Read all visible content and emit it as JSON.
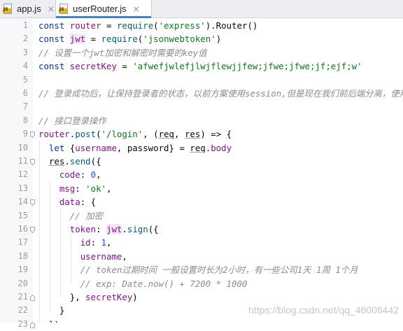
{
  "tabs": [
    {
      "label": "app.js",
      "icon": "js-file-icon",
      "active": false
    },
    {
      "label": "userRouter.js",
      "icon": "js-file-icon",
      "active": true
    }
  ],
  "tab_close_glyph": "×",
  "js_badge": "JS",
  "line_numbers": [
    "1",
    "2",
    "3",
    "4",
    "5",
    "6",
    "7",
    "8",
    "9",
    "10",
    "11",
    "12",
    "13",
    "14",
    "15",
    "16",
    "17",
    "18",
    "19",
    "20",
    "21",
    "22",
    "23"
  ],
  "code": {
    "l1_const": "const",
    "l1_name": "router",
    "l1_eq": " = ",
    "l1_req": "require",
    "l1_open": "(",
    "l1_str": "'express'",
    "l1_rest": ").Router()",
    "l2_const": "const",
    "l2_name": "jwt",
    "l2_eq": " = ",
    "l2_req": "require",
    "l2_open": "(",
    "l2_str": "'jsonwebtoken'",
    "l2_rest": ")",
    "l3": "// 设置一个jwt加密和解密时需要的key值",
    "l4_const": "const",
    "l4_name": "secretKey",
    "l4_eq": " = ",
    "l4_str": "'afwefjwlefjlwjflewjjfew;jfwe;jfwe;jf;ejf;w'",
    "l6": "// 登录成功后，让保持登录者的状态，以前方案使用session,但是现在我们前后端分离，使用jwt",
    "l8": "// 接口登录操作",
    "l9_a": "router",
    "l9_b": ".",
    "l9_c": "post",
    "l9_d": "(",
    "l9_e": "'/login'",
    "l9_f": ", (",
    "l9_g": "req",
    "l9_h": ", ",
    "l9_i": "res",
    "l9_j": ") => {",
    "l10_a": "let",
    "l10_b": " {",
    "l10_c": "username",
    "l10_d": ", password} = ",
    "l10_e": "req",
    "l10_f": ".",
    "l10_g": "body",
    "l11_a": "res",
    "l11_b": ".",
    "l11_c": "send",
    "l11_d": "({",
    "l12_a": "code",
    "l12_b": ": ",
    "l12_c": "0",
    "l12_d": ",",
    "l13_a": "msg",
    "l13_b": ": ",
    "l13_c": "'ok'",
    "l13_d": ",",
    "l14_a": "data",
    "l14_b": ": {",
    "l15": "// 加密",
    "l16_a": "token",
    "l16_b": ": ",
    "l16_c": "jwt",
    "l16_d": ".",
    "l16_e": "sign",
    "l16_f": "({",
    "l17_a": "id",
    "l17_b": ": ",
    "l17_c": "1",
    "l17_d": ",",
    "l18_a": "username",
    "l18_b": ",",
    "l19": "// token过期时间 一般设置时长为2小时，有一些公司1天 1周 1个月",
    "l20": "// exp: Date.now() + 7200 * 1000",
    "l21_a": "}, ",
    "l21_b": "secretKey",
    "l21_c": ")",
    "l22": "}",
    "l23": "})"
  },
  "watermark": "https://blog.csdn.net/qq_46008442",
  "colors": {
    "keyword": "#0033b3",
    "string": "#067d17",
    "number": "#1750eb",
    "property": "#871094",
    "function": "#00627a",
    "comment": "#8c8c8c",
    "tab_underline": "#4083c9"
  }
}
